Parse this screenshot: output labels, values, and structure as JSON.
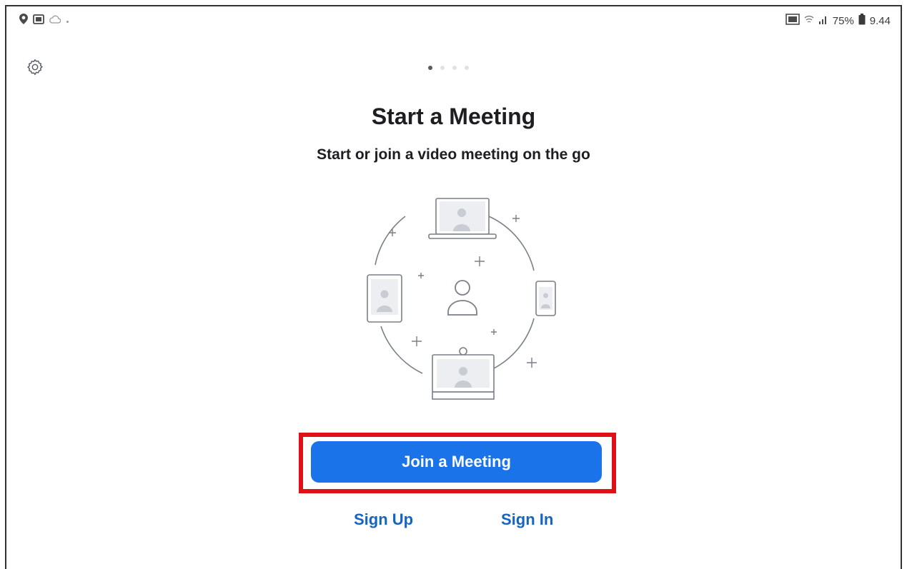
{
  "status_bar": {
    "left_icons": [
      "location-pin-icon",
      "gallery-icon",
      "cloud-icon",
      "dot-icon"
    ],
    "right_icons": [
      "cast-icon",
      "wifi-icon",
      "signal-icon",
      "battery-icon"
    ],
    "battery": "75%",
    "time": "9.44"
  },
  "header": {
    "settings_icon": "gear-icon"
  },
  "pager": {
    "total": 4,
    "active": 0
  },
  "main": {
    "title": "Start a Meeting",
    "subtitle": "Start or join a video meeting on the go"
  },
  "actions": {
    "join_label": "Join a Meeting",
    "signup_label": "Sign Up",
    "signin_label": "Sign In"
  },
  "colors": {
    "primary": "#1a73e8",
    "link": "#1565c0",
    "highlight": "#e0101a"
  }
}
